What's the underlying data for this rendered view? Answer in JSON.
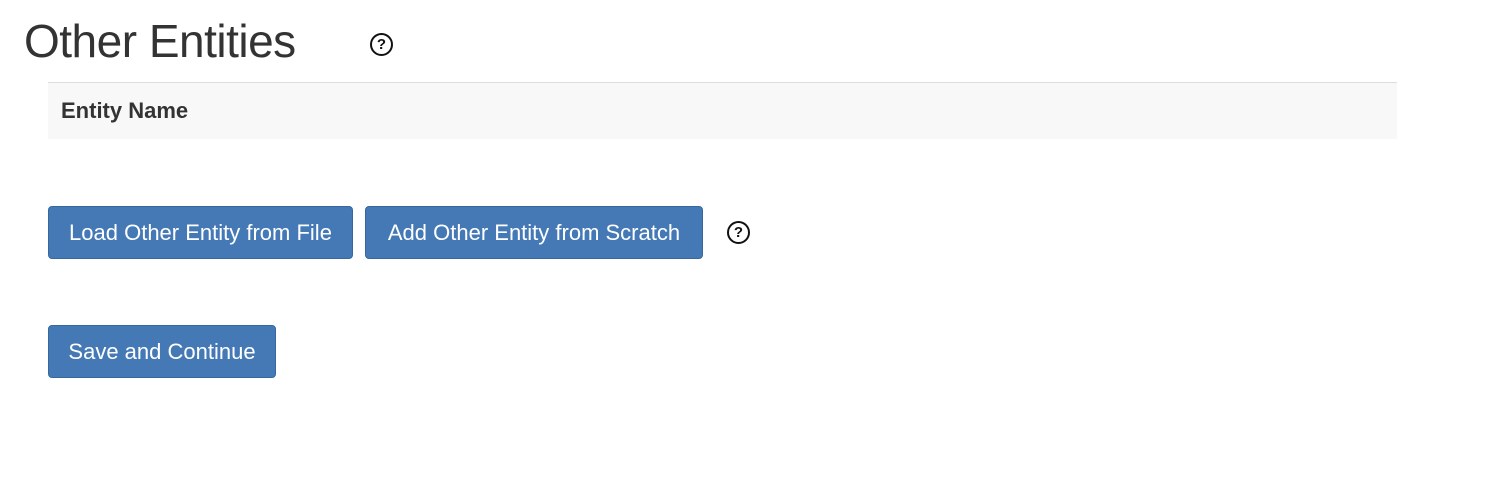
{
  "page": {
    "title": "Other Entities",
    "title_help_icon": "question-circle-icon"
  },
  "table": {
    "columns": [
      "Entity Name"
    ],
    "rows": []
  },
  "actions": {
    "load_label": "Load Other Entity from File",
    "add_label": "Add Other Entity from Scratch",
    "help_icon": "question-circle-icon"
  },
  "footer": {
    "save_label": "Save and Continue"
  },
  "colors": {
    "button_bg": "#4479b6",
    "button_text": "#ffffff",
    "header_bg": "#f8f8f8",
    "text": "#333333"
  },
  "icons": {
    "help_glyph": "?"
  }
}
